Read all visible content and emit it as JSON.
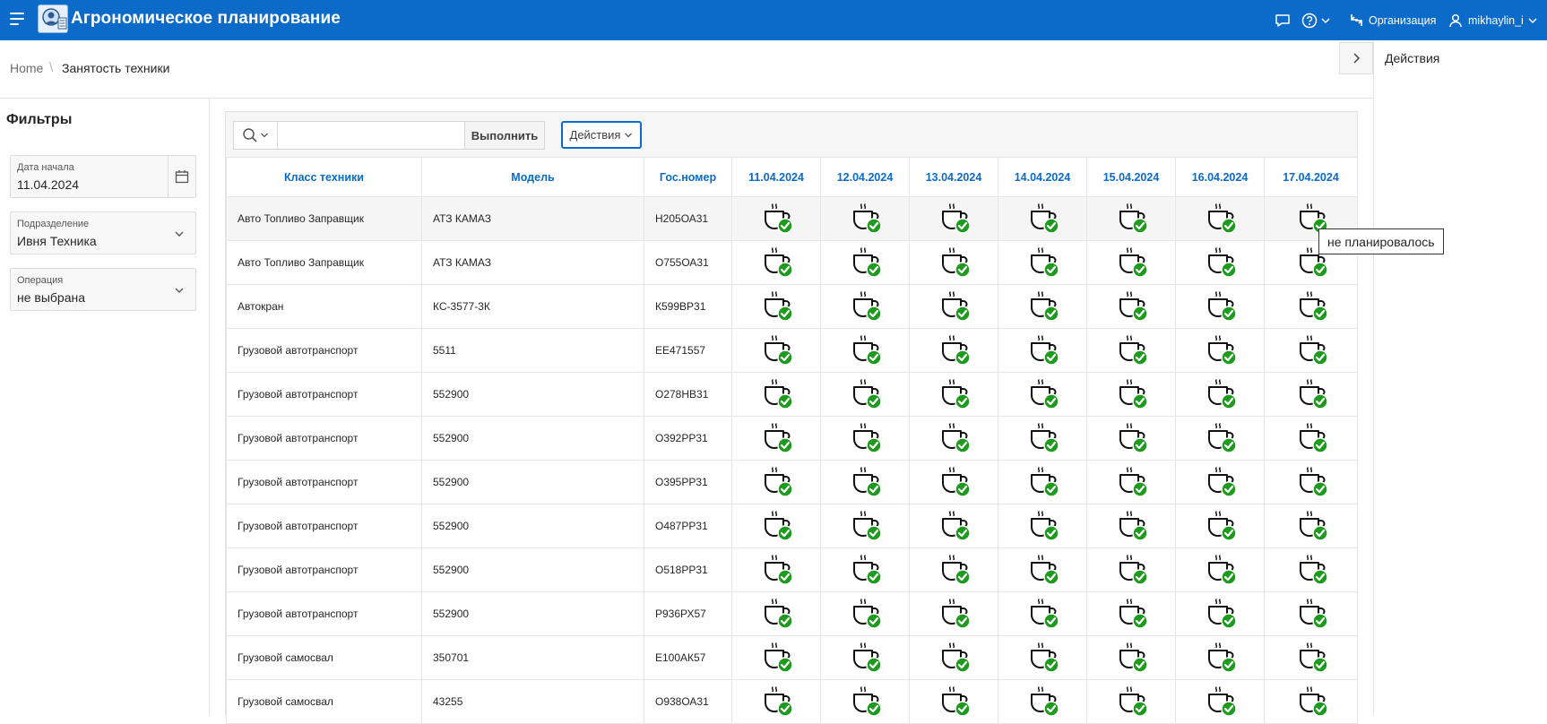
{
  "header": {
    "app_title": "Агрономическое планирование",
    "org_label": "Организация",
    "user_name": "mikhaylin_i"
  },
  "breadcrumb": {
    "home": "Home",
    "separator": "\\",
    "current": "Занятость техники"
  },
  "right_panel": {
    "title": "Действия"
  },
  "filters": {
    "title": "Фильтры",
    "fields": [
      {
        "label": "Дата начала",
        "value": "11.04.2024"
      },
      {
        "label": "Подразделение",
        "value": "Ивня Техника"
      },
      {
        "label": "Операция",
        "value": "не выбрана"
      }
    ]
  },
  "toolbar": {
    "search_placeholder": "",
    "go_label": "Выполнить",
    "actions_label": "Действия"
  },
  "table": {
    "columns": [
      "Класс техники",
      "Модель",
      "Гос.номер",
      "11.04.2024",
      "12.04.2024",
      "13.04.2024",
      "14.04.2024",
      "15.04.2024",
      "16.04.2024",
      "17.04.2024"
    ],
    "rows": [
      {
        "cls": "Авто Топливо Заправщик",
        "model": "АТЗ КАМАЗ",
        "plate": "Н205ОА31"
      },
      {
        "cls": "Авто Топливо Заправщик",
        "model": "АТЗ КАМАЗ",
        "plate": "О755ОА31"
      },
      {
        "cls": "Автокран",
        "model": "КС-3577-3К",
        "plate": "К599ВР31"
      },
      {
        "cls": "Грузовой автотранспорт",
        "model": "5511",
        "plate": "ЕЕ471557"
      },
      {
        "cls": "Грузовой автотранспорт",
        "model": "552900",
        "plate": "О278НВ31"
      },
      {
        "cls": "Грузовой автотранспорт",
        "model": "552900",
        "plate": "О392РР31"
      },
      {
        "cls": "Грузовой автотранспорт",
        "model": "552900",
        "plate": "О395РР31"
      },
      {
        "cls": "Грузовой автотранспорт",
        "model": "552900",
        "plate": "О487РР31"
      },
      {
        "cls": "Грузовой автотранспорт",
        "model": "552900",
        "plate": "О518РР31"
      },
      {
        "cls": "Грузовой автотранспорт",
        "model": "552900",
        "plate": "Р936РХ57"
      },
      {
        "cls": "Грузовой самосвал",
        "model": "350701",
        "plate": "Е100АК57"
      },
      {
        "cls": "Грузовой самосвал",
        "model": "43255",
        "plate": "О938ОА31"
      }
    ],
    "status_icon": "coffee-cup-check-icon"
  },
  "tooltip": {
    "text": "не планировалось"
  },
  "colors": {
    "brand": "#0c6bc8",
    "check": "#1e9a1e"
  }
}
